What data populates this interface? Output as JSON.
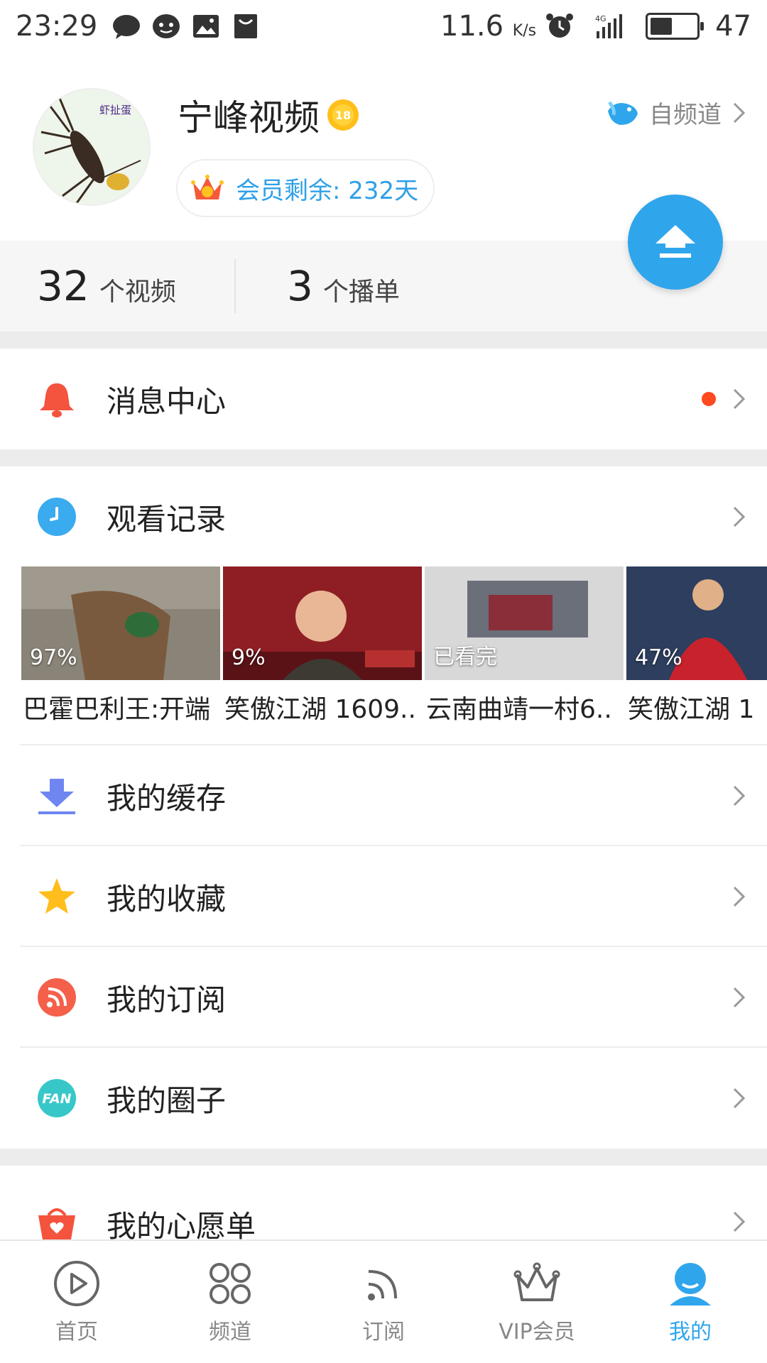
{
  "status_bar": {
    "time": "23:29",
    "net_speed": "11.6",
    "net_unit": "K/s",
    "battery": "47",
    "battery_level": 0.47
  },
  "profile": {
    "username": "宁峰视频",
    "level": "18",
    "avatar_text": "虾扯蛋",
    "vip_remaining": "会员剩余: 232天",
    "self_channel": "自频道"
  },
  "stats": {
    "videos_count": "32",
    "videos_unit": "个视频",
    "playlists_count": "3",
    "playlists_unit": "个播单"
  },
  "menu": {
    "message_center": "消息中心",
    "watch_history": "观看记录",
    "my_cache": "我的缓存",
    "my_favorites": "我的收藏",
    "my_subscriptions": "我的订阅",
    "my_circles": "我的圈子",
    "my_wishlist": "我的心愿单"
  },
  "history": [
    {
      "progress": "97%",
      "title": "巴霍巴利王:开端"
    },
    {
      "progress": "9%",
      "title": "笑傲江湖 1609.."
    },
    {
      "progress": "已看完",
      "title": "云南曲靖一村6.."
    },
    {
      "progress": "47%",
      "title": "笑傲江湖 1"
    }
  ],
  "tabs": [
    {
      "label": "首页"
    },
    {
      "label": "频道"
    },
    {
      "label": "订阅"
    },
    {
      "label": "VIP会员"
    },
    {
      "label": "我的"
    }
  ],
  "colors": {
    "accent": "#2fa6ec",
    "red_dot": "#ff4a1f",
    "bell": "#f4533d",
    "history_icon": "#3aabef",
    "cache_icon": "#6f86f2",
    "star": "#ffbe1c",
    "subscription_icon": "#f4604a",
    "circle_icon": "#37c7c9",
    "wishlist_icon": "#f4533d"
  }
}
